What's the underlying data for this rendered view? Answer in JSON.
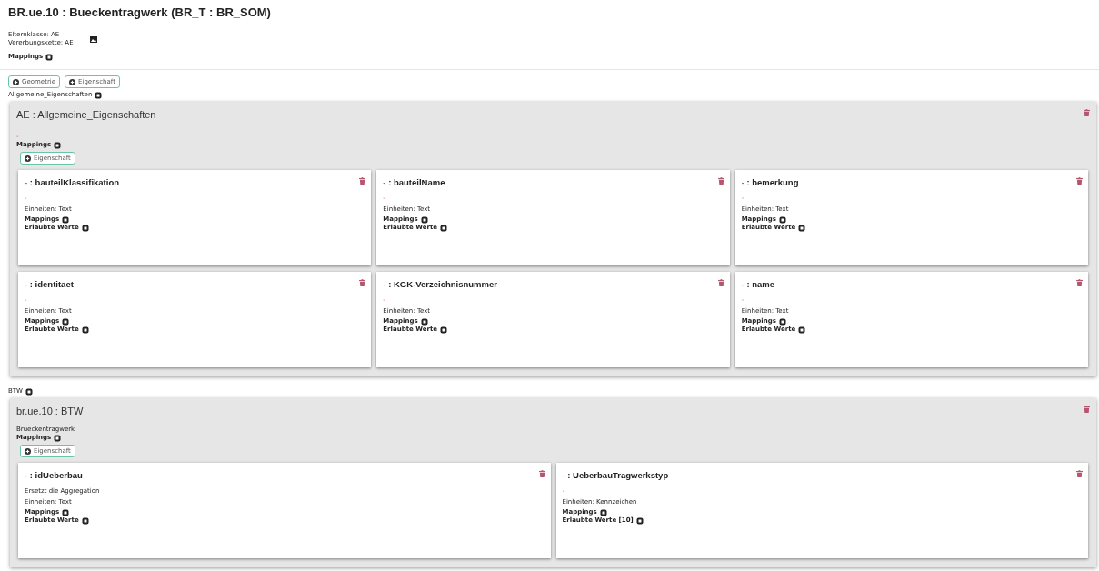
{
  "title": "BR.ue.10 : Bueckentragwerk (BR_T : BR_SOM)",
  "meta": [
    "Elternklasse: AE",
    "Vererbungskette: AE"
  ],
  "mappings_label": "Mappings",
  "add_buttons": [
    "Geometrie",
    "Eigenschaft"
  ],
  "groups": [
    {
      "heading": "Allgemeine_Eigenschaften",
      "title": "AE : Allgemeine_Eigenschaften",
      "description": {
        "text": "-",
        "empty": true
      },
      "mappings_label": "Mappings",
      "add_button": "Eigenschaft",
      "cards": [
        {
          "prefix": "-",
          "name": ": bauteilKlassifikation",
          "description": {
            "text": "-",
            "empty": true
          },
          "units": "Einheiten: Text",
          "mappings_label": "Mappings",
          "values_label": "Erlaubte Werte"
        },
        {
          "prefix": "-",
          "name": ": bauteilName",
          "description": {
            "text": "-",
            "empty": true
          },
          "units": "Einheiten: Text",
          "mappings_label": "Mappings",
          "values_label": "Erlaubte Werte"
        },
        {
          "prefix": "-",
          "name": ": bemerkung",
          "description": {
            "text": "-",
            "empty": true
          },
          "units": "Einheiten: Text",
          "mappings_label": "Mappings",
          "values_label": "Erlaubte Werte"
        },
        {
          "prefix": "-",
          "name": ": identitaet",
          "description": {
            "text": "-",
            "empty": true
          },
          "units": "Einheiten: Text",
          "mappings_label": "Mappings",
          "values_label": "Erlaubte Werte"
        },
        {
          "prefix": "-",
          "name": ": KGK-Verzeichnisnummer",
          "description": {
            "text": "-",
            "empty": true
          },
          "units": "Einheiten: Text",
          "mappings_label": "Mappings",
          "values_label": "Erlaubte Werte"
        },
        {
          "prefix": "-",
          "name": ": name",
          "description": {
            "text": "-",
            "empty": true
          },
          "units": "Einheiten: Text",
          "mappings_label": "Mappings",
          "values_label": "Erlaubte Werte"
        }
      ]
    },
    {
      "heading": "BTW",
      "title": "br.ue.10 : BTW",
      "description": {
        "text": "Brueckentragwerk",
        "empty": false
      },
      "mappings_label": "Mappings",
      "add_button": "Eigenschaft",
      "cards": [
        {
          "prefix": "-",
          "name": ": idUeberbau",
          "description": {
            "text": "Ersetzt die Aggregation",
            "empty": false
          },
          "units": "Einheiten: Text",
          "mappings_label": "Mappings",
          "values_label": "Erlaubte Werte"
        },
        {
          "prefix": "-",
          "name": ": UeberbauTragwerkstyp",
          "description": {
            "text": "-",
            "empty": true
          },
          "units": "Einheiten: Kennzeichen",
          "mappings_label": "Mappings",
          "values_label": "Erlaubte Werte [10]"
        }
      ]
    }
  ]
}
